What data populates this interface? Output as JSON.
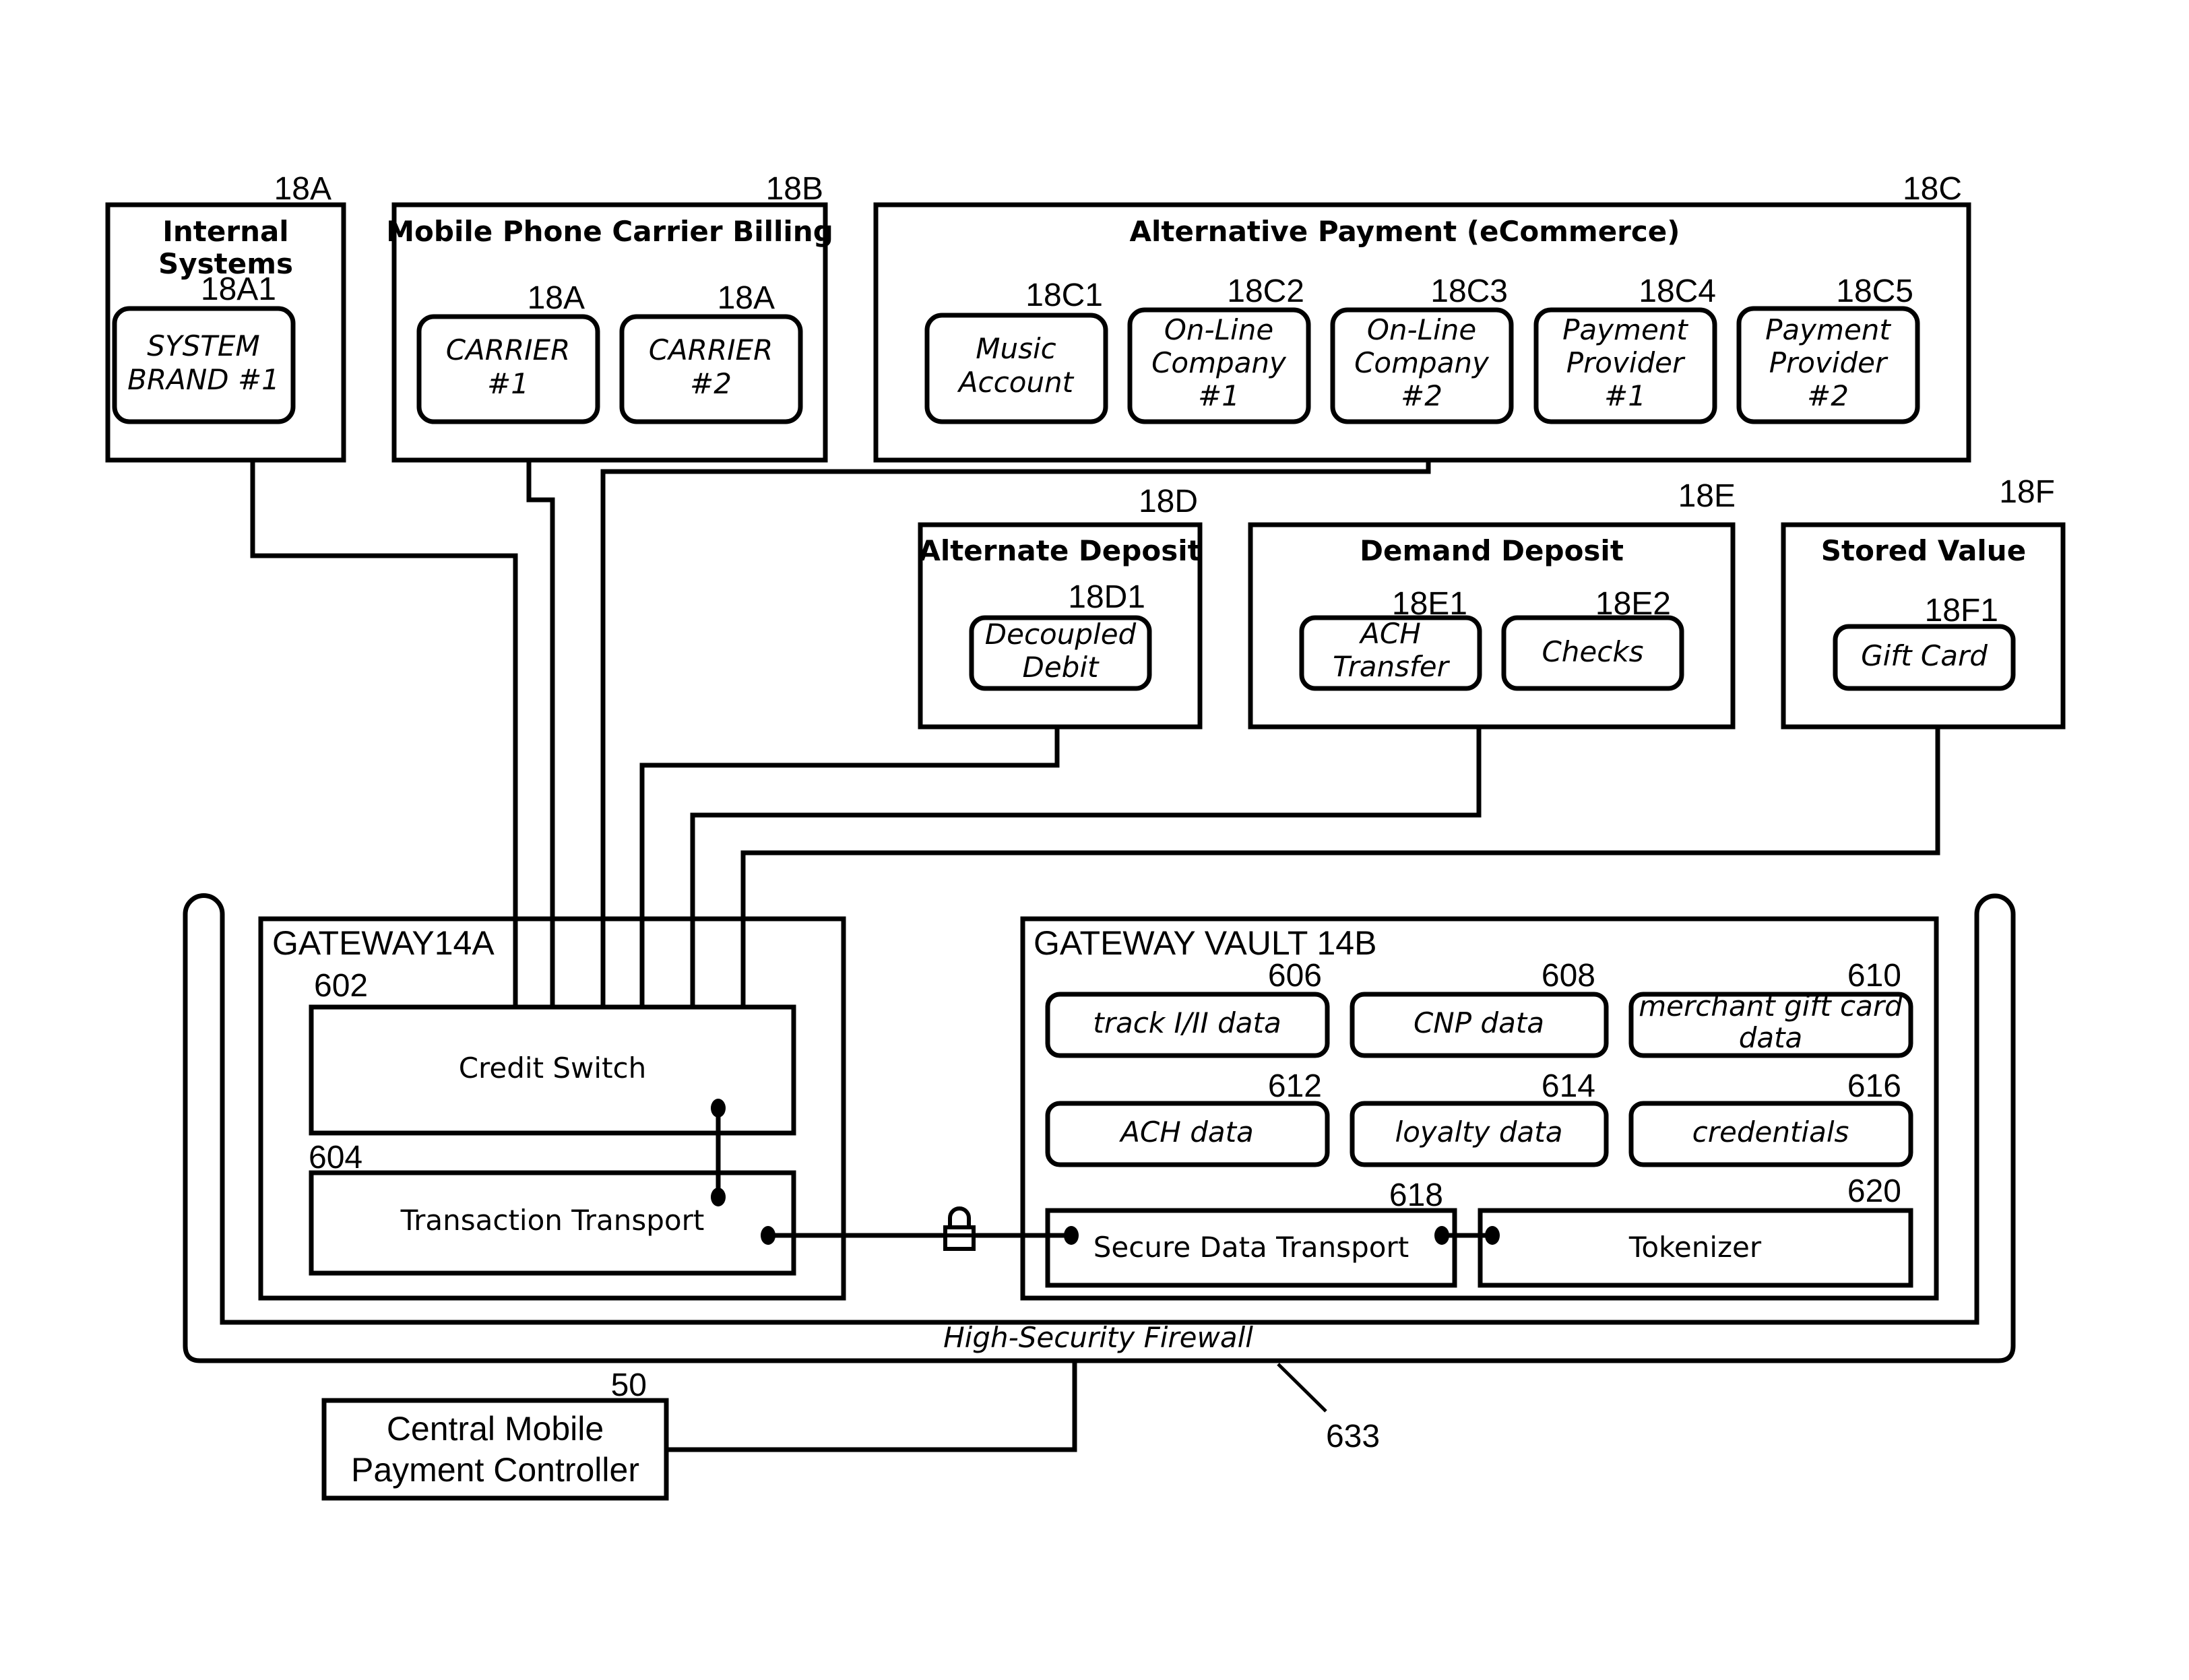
{
  "sources": {
    "internal_systems": {
      "ref": "18A",
      "title_line1": "Internal",
      "title_line2": "Systems",
      "items": [
        {
          "ref": "18A1",
          "line1": "SYSTEM",
          "line2": "BRAND #1"
        }
      ]
    },
    "carrier_billing": {
      "ref": "18B",
      "title": "Mobile Phone Carrier Billing",
      "items": [
        {
          "ref": "18A",
          "line1": "CARRIER",
          "line2": "#1"
        },
        {
          "ref": "18A",
          "line1": "CARRIER",
          "line2": "#2"
        }
      ]
    },
    "alternative_payment": {
      "ref": "18C",
      "title": "Alternative Payment  (eCommerce)",
      "items": [
        {
          "ref": "18C1",
          "line1": "Music",
          "line2": "Account",
          "line3": ""
        },
        {
          "ref": "18C2",
          "line1": "On-Line",
          "line2": "Company",
          "line3": "#1"
        },
        {
          "ref": "18C3",
          "line1": "On-Line",
          "line2": "Company",
          "line3": "#2"
        },
        {
          "ref": "18C4",
          "line1": "Payment",
          "line2": "Provider",
          "line3": "#1"
        },
        {
          "ref": "18C5",
          "line1": "Payment",
          "line2": "Provider",
          "line3": "#2"
        }
      ]
    },
    "alternate_deposit": {
      "ref": "18D",
      "title": "Alternate Deposit",
      "items": [
        {
          "ref": "18D1",
          "line1": "Decoupled",
          "line2": "Debit"
        }
      ]
    },
    "demand_deposit": {
      "ref": "18E",
      "title": "Demand Deposit",
      "items": [
        {
          "ref": "18E1",
          "line1": "ACH",
          "line2": "Transfer"
        },
        {
          "ref": "18E2",
          "line1": "Checks",
          "line2": ""
        }
      ]
    },
    "stored_value": {
      "ref": "18F",
      "title": "Stored Value",
      "items": [
        {
          "ref": "18F1",
          "line1": "Gift Card",
          "line2": ""
        }
      ]
    }
  },
  "gateway": {
    "title": "GATEWAY14A",
    "credit_switch": {
      "ref": "602",
      "label": "Credit Switch"
    },
    "transaction_transport": {
      "ref": "604",
      "label": "Transaction Transport"
    }
  },
  "vault": {
    "title": "GATEWAY VAULT 14B",
    "items": [
      {
        "ref": "606",
        "line1": "track I/II data",
        "line2": ""
      },
      {
        "ref": "608",
        "line1": "CNP data",
        "line2": ""
      },
      {
        "ref": "610",
        "line1": "merchant gift card",
        "line2": "data"
      },
      {
        "ref": "612",
        "line1": "ACH data",
        "line2": ""
      },
      {
        "ref": "614",
        "line1": "loyalty data",
        "line2": ""
      },
      {
        "ref": "616",
        "line1": "credentials",
        "line2": ""
      }
    ],
    "secure_data_transport": {
      "ref": "618",
      "label": "Secure Data Transport"
    },
    "tokenizer": {
      "ref": "620",
      "label": "Tokenizer"
    }
  },
  "firewall": {
    "label": "High-Security Firewall",
    "ref": "633"
  },
  "controller": {
    "ref": "50",
    "line1": "Central Mobile",
    "line2": "Payment Controller"
  },
  "icons": {
    "lock": "lock-icon"
  }
}
